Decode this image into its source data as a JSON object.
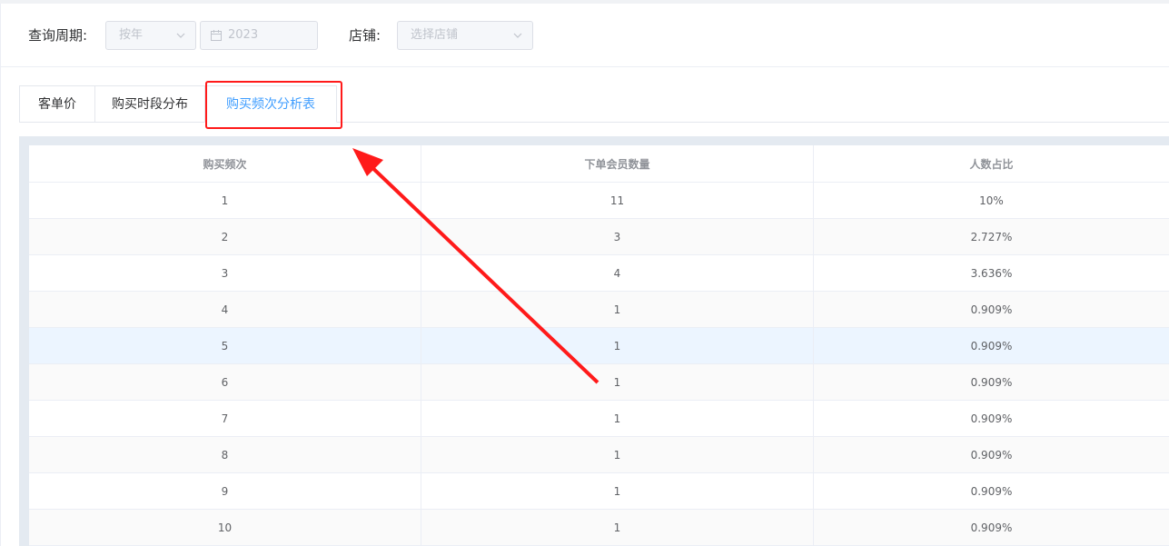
{
  "filters": {
    "period_label": "查询周期:",
    "period_type": "按年",
    "year": "2023",
    "shop_label": "店铺:",
    "shop_placeholder": "选择店铺"
  },
  "tabs": [
    {
      "label": "客单价",
      "active": false
    },
    {
      "label": "购买时段分布",
      "active": false
    },
    {
      "label": "购买频次分析表",
      "active": true
    }
  ],
  "table": {
    "headers": [
      "购买频次",
      "下单会员数量",
      "人数占比"
    ],
    "rows": [
      [
        "1",
        "11",
        "10%"
      ],
      [
        "2",
        "3",
        "2.727%"
      ],
      [
        "3",
        "4",
        "3.636%"
      ],
      [
        "4",
        "1",
        "0.909%"
      ],
      [
        "5",
        "1",
        "0.909%"
      ],
      [
        "6",
        "1",
        "0.909%"
      ],
      [
        "7",
        "1",
        "0.909%"
      ],
      [
        "8",
        "1",
        "0.909%"
      ],
      [
        "9",
        "1",
        "0.909%"
      ],
      [
        "10",
        "1",
        "0.909%"
      ]
    ]
  },
  "colors": {
    "accent": "#409eff",
    "annotation": "#ff1a1a"
  }
}
